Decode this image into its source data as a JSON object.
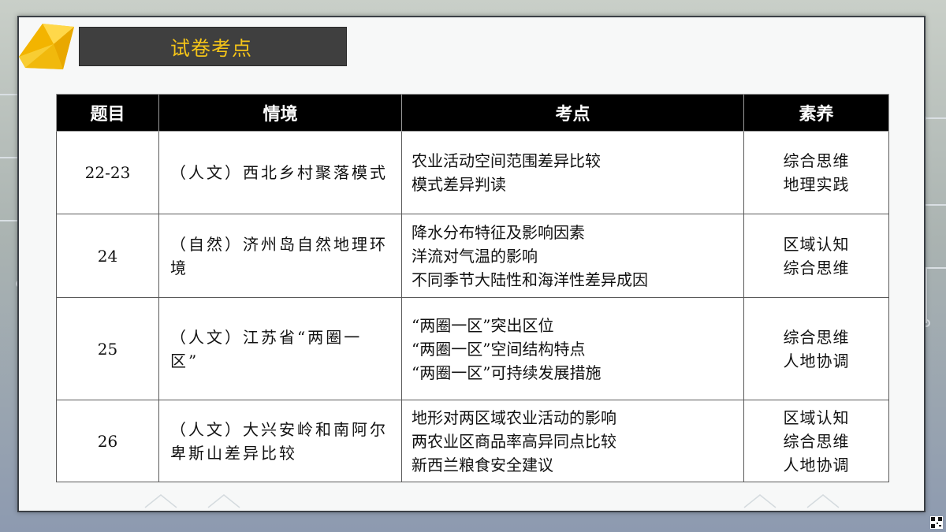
{
  "title": "试卷考点",
  "table": {
    "headers": [
      "题目",
      "情境",
      "考点",
      "素养"
    ],
    "rows": [
      {
        "num": "22-23",
        "situation": "（人文）西北乡村聚落模式",
        "points": [
          "农业活动空间范围差异比较",
          "模式差异判读"
        ],
        "literacy": [
          "综合思维",
          "地理实践"
        ]
      },
      {
        "num": "24",
        "situation": "（自然）济州岛自然地理环境",
        "points": [
          "降水分布特征及影响因素",
          "洋流对气温的影响",
          "不同季节大陆性和海洋性差异成因"
        ],
        "literacy": [
          "区域认知",
          "综合思维"
        ]
      },
      {
        "num": "25",
        "situation": "（人文）江苏省“两圈一区”",
        "points": [
          "“两圈一区”突出区位",
          "“两圈一区”空间结构特点",
          "“两圈一区”可持续发展措施"
        ],
        "literacy": [
          "综合思维",
          "人地协调"
        ]
      },
      {
        "num": "26",
        "situation": "（人文）大兴安岭和南阿尔卑斯山差异比较",
        "points": [
          "地形对两区域农业活动的影响",
          "两农业区商品率高异同点比较",
          "新西兰粮食安全建议"
        ],
        "literacy": [
          "区域认知",
          "综合思维",
          "人地协调"
        ]
      }
    ]
  },
  "colors": {
    "accent": "#f5c518",
    "header_bg": "#000000",
    "title_bar_bg": "#3f3f3f"
  }
}
